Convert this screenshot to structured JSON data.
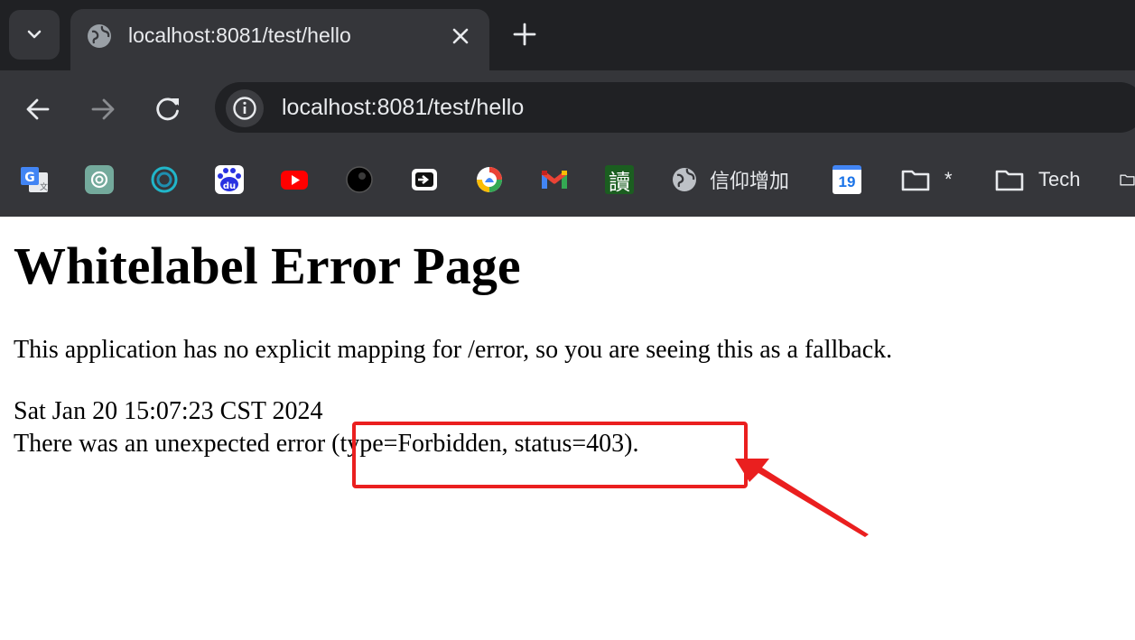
{
  "browser": {
    "tab": {
      "title": "localhost:8081/test/hello"
    },
    "address_bar": {
      "url": "localhost:8081/test/hello"
    },
    "bookmarks": [
      {
        "icon": "google-translate-icon",
        "label": ""
      },
      {
        "icon": "chatgpt-icon",
        "label": ""
      },
      {
        "icon": "swirl-logo-icon",
        "label": ""
      },
      {
        "icon": "baidu-icon",
        "label": ""
      },
      {
        "icon": "youtube-icon",
        "label": ""
      },
      {
        "icon": "black-circle-icon",
        "label": ""
      },
      {
        "icon": "export-icon",
        "label": ""
      },
      {
        "icon": "colorful-bird-icon",
        "label": ""
      },
      {
        "icon": "gmail-icon",
        "label": ""
      },
      {
        "icon": "du-character-icon",
        "label": ""
      },
      {
        "icon": "globe-icon",
        "label": "信仰增加"
      },
      {
        "icon": "calendar-icon",
        "label": ""
      },
      {
        "icon": "folder-icon",
        "label": "*"
      },
      {
        "icon": "folder-icon",
        "label": "Tech"
      }
    ],
    "calendar_day": "19",
    "du_character": "讀"
  },
  "page": {
    "heading": "Whitelabel Error Page",
    "line1": "This application has no explicit mapping for /error, so you are seeing this as a fallback.",
    "timestamp": "Sat Jan 20 15:07:23 CST 2024",
    "error_line": "There was an unexpected error (type=Forbidden, status=403)."
  },
  "annotation": {
    "color": "#ea1f1f"
  }
}
